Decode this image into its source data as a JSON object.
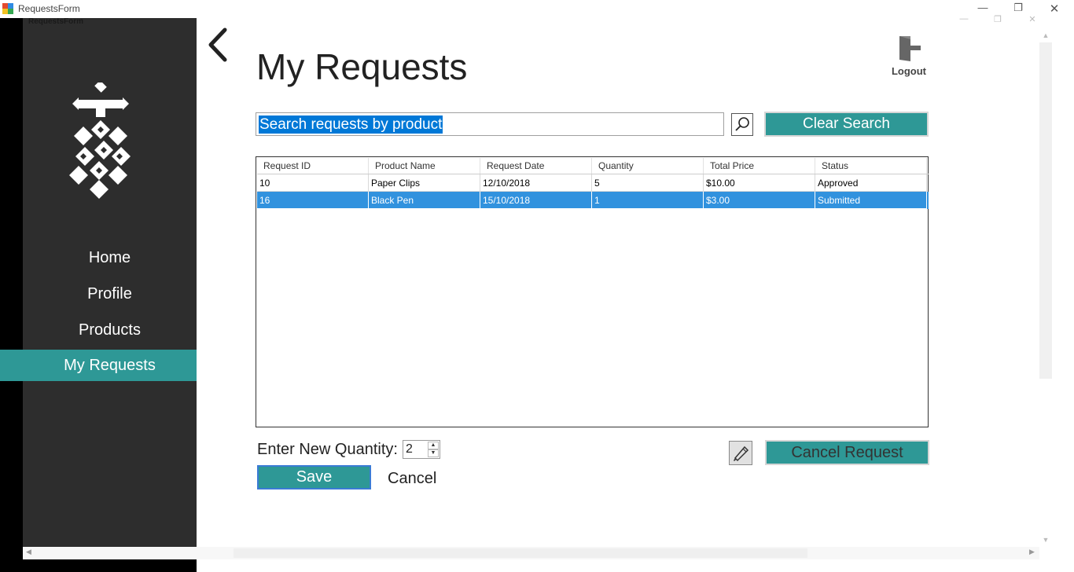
{
  "window": {
    "title": "RequestsForm",
    "inner_title": "RequestsForm"
  },
  "colors": {
    "accent": "#2e9896",
    "sidebar": "#2d2d2d",
    "selection": "#3192de"
  },
  "sidebar": {
    "items": [
      {
        "label": "Home",
        "active": false
      },
      {
        "label": "Profile",
        "active": false
      },
      {
        "label": "Products",
        "active": false
      },
      {
        "label": "My Requests",
        "active": true
      }
    ]
  },
  "header": {
    "title": "My Requests",
    "logout_label": "Logout"
  },
  "search": {
    "value": "Search requests by product",
    "clear_label": "Clear Search"
  },
  "table": {
    "columns": [
      "Request ID",
      "Product Name",
      "Request Date",
      "Quantity",
      "Total Price",
      "Status"
    ],
    "rows": [
      [
        "10",
        "Paper Clips",
        "12/10/2018",
        "5",
        "$10.00",
        "Approved"
      ],
      [
        "16",
        "Black Pen",
        "15/10/2018",
        "1",
        "$3.00",
        "Submitted"
      ]
    ],
    "selected_row": 1
  },
  "edit": {
    "quantity_label": "Enter New Quantity:",
    "quantity_value": "2",
    "save_label": "Save",
    "cancel_label": "Cancel",
    "cancel_request_label": "Cancel Request"
  },
  "icons": [
    "app-icon",
    "back-arrow-icon",
    "logout-icon",
    "search-icon",
    "pencil-icon",
    "logo-icon"
  ]
}
